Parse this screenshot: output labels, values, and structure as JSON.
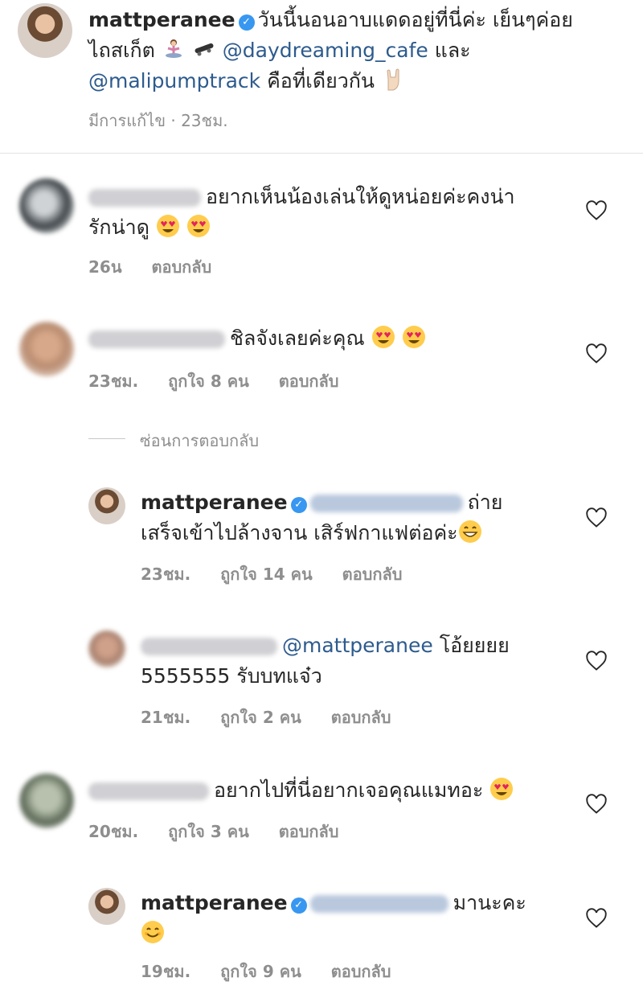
{
  "post": {
    "username": "mattperanee",
    "caption_line1": "วันนี้นอนอาบแดดอยู่ที่นี่ค่ะ เย็นๆค่อย",
    "caption_line2_prefix": "ไถสเก็ต",
    "mention1": "@daydreaming_cafe",
    "caption_line2_suffix": "และ",
    "mention2": "@malipumptrack",
    "caption_line3_suffix": "คือที่เดียวกัน",
    "meta": "มีการแก้ไข · 23ชม."
  },
  "comments": [
    {
      "text_line1": "อยากเห็นน้องเล่นให้ดูหน่อยค่ะคงน่า",
      "text_line2": "รักน่าดู",
      "time": "26น",
      "reply": "ตอบกลับ"
    },
    {
      "text_line1": "ชิลจังเลยค่ะคุณ",
      "time": "23ชม.",
      "likes": "ถูกใจ 8 คน",
      "reply": "ตอบกลับ",
      "hide_replies": "ซ่อนการตอบกลับ"
    },
    {
      "username": "mattperanee",
      "text_line1_end": "ถ่าย",
      "text_line2": "เสร็จเข้าไปล้างจาน เสิร์ฟกาแฟต่อค่ะ",
      "time": "23ชม.",
      "likes": "ถูกใจ 14 คน",
      "reply": "ตอบกลับ"
    },
    {
      "mention": "@mattperanee",
      "text_line1_end": "โอ้ยยยย",
      "text_line2": "5555555 รับบทแจ๋ว",
      "time": "21ชม.",
      "likes": "ถูกใจ 2 คน",
      "reply": "ตอบกลับ"
    },
    {
      "text_line1": "อยากไปที่นี่อยากเจอคุณแมทอะ",
      "time": "20ชม.",
      "likes": "ถูกใจ 3 คน",
      "reply": "ตอบกลับ"
    },
    {
      "username": "mattperanee",
      "text_line1_end": "มานะคะ",
      "time": "19ชม.",
      "likes": "ถูกใจ 9 คน",
      "reply": "ตอบกลับ"
    }
  ],
  "icons": {
    "verified": "verified-badge-icon",
    "heart": "heart-outline-icon",
    "emoji_heart_eyes": "heart-eyes-emoji",
    "emoji_grin": "grin-emoji",
    "emoji_smile": "smile-emoji",
    "emoji_rock": "rock-hand-emoji",
    "emoji_yoga": "yoga-emoji",
    "emoji_skate": "skateboard-emoji"
  },
  "colors": {
    "mention": "#2d5b8e",
    "meta": "#8e8e8e",
    "verified": "#3897f0"
  }
}
